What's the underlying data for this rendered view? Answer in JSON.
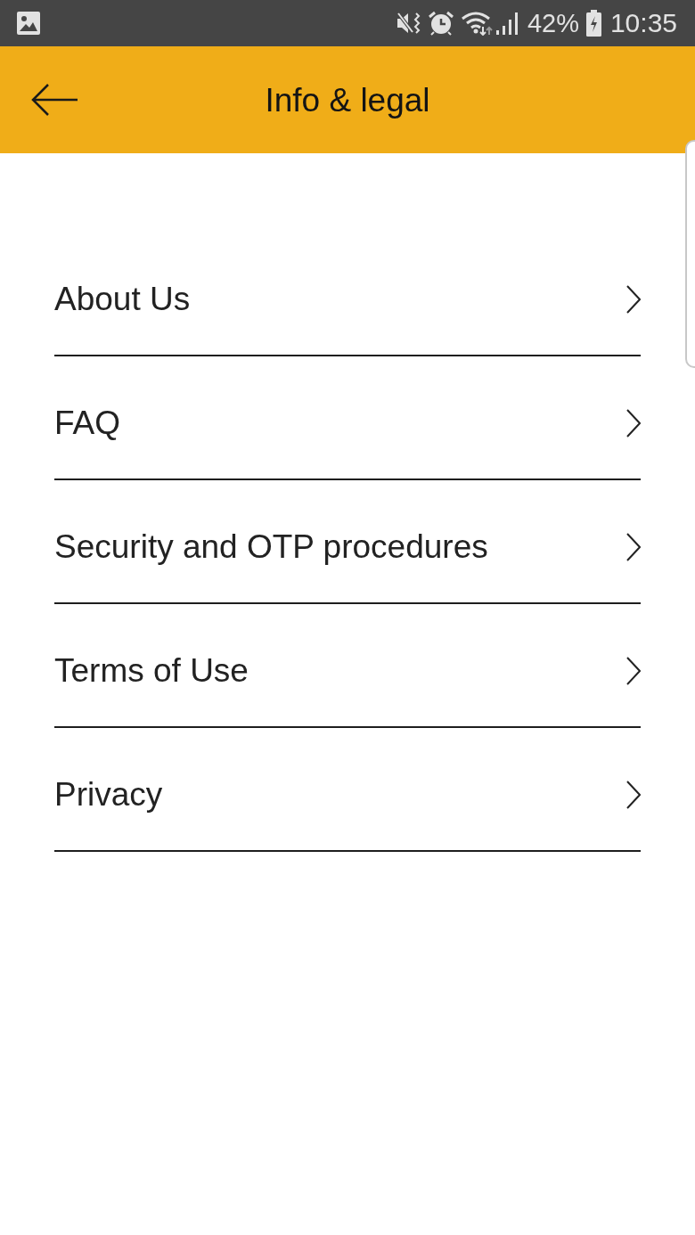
{
  "status_bar": {
    "battery": "42%",
    "time": "10:35"
  },
  "app_bar": {
    "title": "Info & legal"
  },
  "menu_items": [
    {
      "label": "About Us"
    },
    {
      "label": "FAQ"
    },
    {
      "label": "Security and OTP procedures"
    },
    {
      "label": "Terms of Use"
    },
    {
      "label": "Privacy"
    }
  ]
}
